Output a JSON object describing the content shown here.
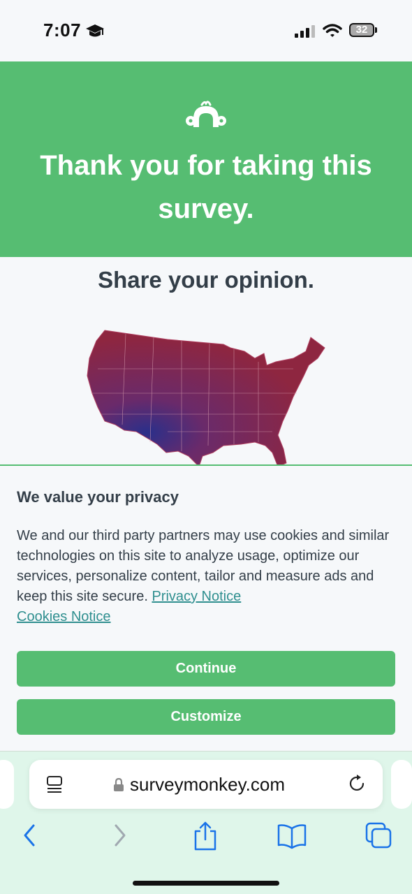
{
  "status_bar": {
    "time": "7:07",
    "battery": "32"
  },
  "hero": {
    "title": "Thank you for taking this survey."
  },
  "content": {
    "subtitle": "Share your opinion."
  },
  "privacy": {
    "title": "We value your privacy",
    "text": "We and our third party partners may use cookies and similar technologies on this site to analyze usage, optimize our services, personalize content, tailor and measure ads and keep this site secure.",
    "privacy_link": "Privacy Notice",
    "cookies_link": "Cookies Notice",
    "continue_label": "Continue",
    "customize_label": "Customize"
  },
  "browser": {
    "url": "surveymonkey.com"
  },
  "colors": {
    "brand_green": "#56bd72",
    "text_dark": "#333e48",
    "link_teal": "#2f8f8f",
    "ios_blue": "#1a73e8"
  },
  "icons": [
    "graduation-cap-icon",
    "signal-icon",
    "wifi-icon",
    "battery-icon",
    "surveymonkey-logo-icon",
    "reader-icon",
    "lock-icon",
    "reload-icon",
    "back-icon",
    "forward-icon",
    "share-icon",
    "bookmarks-icon",
    "tabs-icon"
  ]
}
